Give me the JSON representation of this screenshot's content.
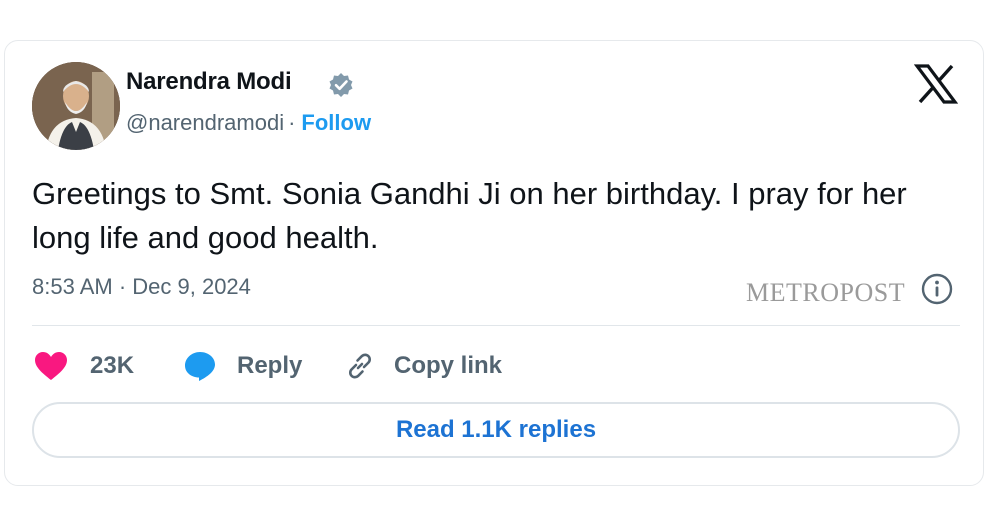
{
  "author": {
    "name": "Narendra Modi",
    "handle": "@narendramodi",
    "separator": "·",
    "follow_label": "Follow"
  },
  "tweet": {
    "text": "Greetings to Smt. Sonia Gandhi Ji on her birthday. I pray for her long life and good health.",
    "timestamp": "8:53 AM · Dec 9, 2024"
  },
  "watermark": "METROPOST",
  "actions": {
    "likes_count": "23K",
    "reply_label": "Reply",
    "copy_label": "Copy link"
  },
  "read_replies_label": "Read 1.1K replies",
  "colors": {
    "accent_blue": "#1d9bf0",
    "like_pink": "#f91880",
    "text_secondary": "#536471"
  },
  "icons": [
    "verified-badge-icon",
    "x-logo-icon",
    "info-icon",
    "heart-icon",
    "reply-bubble-icon",
    "link-icon"
  ]
}
